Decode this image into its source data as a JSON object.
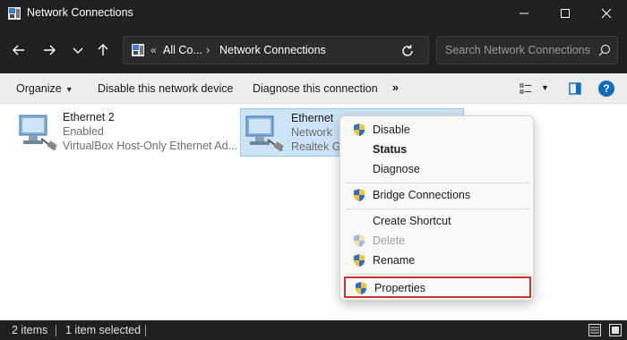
{
  "window": {
    "title": "Network Connections",
    "icon": "network-connections-icon"
  },
  "navigation": {
    "address_overflow": "«",
    "address_segments": [
      "All Co...",
      "Network Connections"
    ],
    "address_separator": "›",
    "search_placeholder": "Search Network Connections"
  },
  "commandbar": {
    "organize": "Organize",
    "disable": "Disable this network device",
    "diagnose": "Diagnose this connection",
    "more": "»",
    "help": "?"
  },
  "items": [
    {
      "name": "Ethernet 2",
      "status": "Enabled",
      "device": "VirtualBox Host-Only Ethernet Ad...",
      "selected": false
    },
    {
      "name": "Ethernet",
      "status": "Network",
      "device": "Realtek Ga",
      "selected": true
    }
  ],
  "context_menu": {
    "items": [
      {
        "label": "Disable",
        "shield": true
      },
      {
        "label": "Status",
        "bold": true
      },
      {
        "label": "Diagnose"
      },
      {
        "label": "Bridge Connections",
        "shield": true
      },
      {
        "label": "Create Shortcut"
      },
      {
        "label": "Delete",
        "shield": true,
        "disabled": true
      },
      {
        "label": "Rename",
        "shield": true
      },
      {
        "label": "Properties",
        "shield": true,
        "highlighted": true
      }
    ]
  },
  "statusbar": {
    "count": "2 items",
    "selection": "1 item selected"
  },
  "colors": {
    "accent": "#0f6cbd",
    "highlight_border": "#d32f2f",
    "selection_bg": "#cce4f7",
    "dark_chrome": "#202020"
  }
}
